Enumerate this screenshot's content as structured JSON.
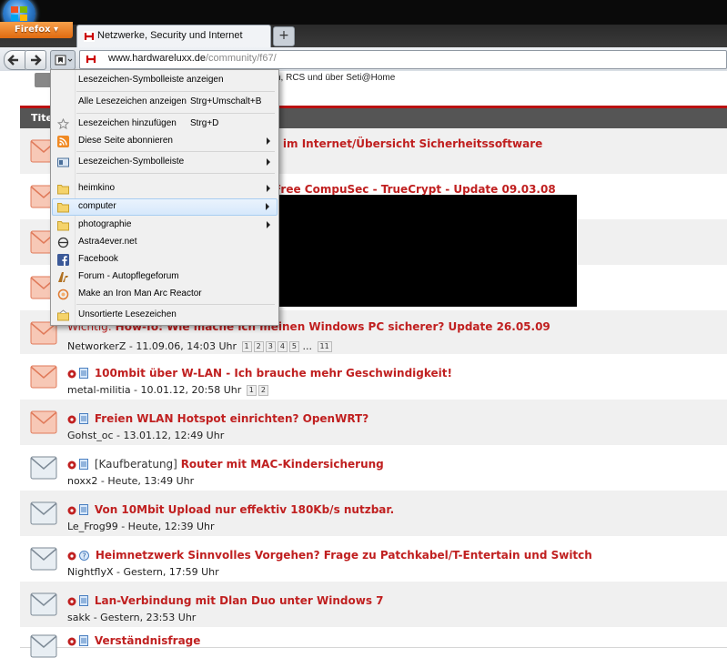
{
  "browser": {
    "app_button": "Firefox",
    "tab_title": "Netzwerke, Security und Internet",
    "newtab_label": "+",
    "url": {
      "host": "www.hardwareluxx.de",
      "path": "/community/f67/"
    }
  },
  "page": {
    "top_info": "n, RCS und über Seti@Home",
    "table_header": "Tite"
  },
  "bookmarks_menu": {
    "items": [
      {
        "label": "Lesezeichen-Symbolleiste anzeigen"
      },
      {
        "label": "Alle Lesezeichen anzeigen",
        "shortcut": "Strg+Umschalt+B"
      },
      {
        "label": "Lesezeichen hinzufügen",
        "shortcut": "Strg+D"
      },
      {
        "label": "Diese Seite abonnieren"
      },
      {
        "label": "Lesezeichen-Symbolleiste"
      },
      {
        "label": "heimkino"
      },
      {
        "label": "computer"
      },
      {
        "label": "photographie"
      },
      {
        "label": "Astra4ever.net"
      },
      {
        "label": "Facebook"
      },
      {
        "label": "Forum - Autopflegeforum"
      },
      {
        "label": "Make an Iron Man Arc Reactor"
      },
      {
        "label": "Unsortierte Lesezeichen"
      }
    ]
  },
  "threads": [
    {
      "title_visible": "t im Internet/Übersicht Sicherheitssoftware"
    },
    {
      "title_visible": "Free CompuSec - TrueCrypt - Update 09.03.08"
    },
    {
      "title_visible": "",
      "meta": ""
    },
    {
      "title_visible": "",
      "meta": ""
    },
    {
      "prefix": "Wichtig:",
      "title": "How-To: Wie mache ich meinen Windows PC sicherer? Update 26.05.09",
      "meta": "NetworkerZ - 11.09.06, 14:03 Uhr",
      "pages": [
        "1",
        "2",
        "3",
        "4",
        "5"
      ],
      "ellipsis": "...",
      "last_page": "11"
    },
    {
      "title": "100mbit über W-LAN - Ich brauche mehr Geschwindigkeit!",
      "meta": "metal-militia - 10.01.12, 20:58 Uhr",
      "pages": [
        "1",
        "2"
      ]
    },
    {
      "title": "Freien WLAN Hotspot einrichten? OpenWRT?",
      "meta": "Gohst_oc - 13.01.12, 12:49 Uhr"
    },
    {
      "prefix": "[Kaufberatung]",
      "title": "Router mit MAC-Kindersicherung",
      "meta": "noxx2 - Heute, 13:49 Uhr"
    },
    {
      "title": "Von 10Mbit Upload nur effektiv 180Kb/s nutzbar.",
      "meta": "Le_Frog99 - Heute, 12:39 Uhr"
    },
    {
      "title": "Heimnetzwerk Sinnvolles Vorgehen? Frage zu Patchkabel/T-Entertain und Switch",
      "meta": "NightflyX - Gestern, 17:59 Uhr"
    },
    {
      "title": "Lan-Verbindung mit Dlan Duo unter Windows 7",
      "meta": "sakk - Gestern, 23:53 Uhr"
    },
    {
      "title": "Verständnisfrage"
    }
  ],
  "colors": {
    "thread_title": "#c02020",
    "accent_line": "#b11111",
    "firefox_button": "#e8761f"
  }
}
